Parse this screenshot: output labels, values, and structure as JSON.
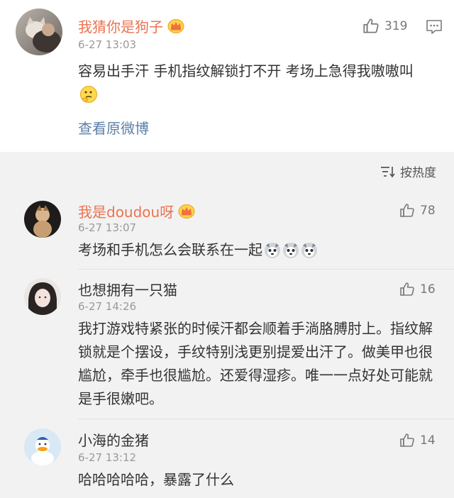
{
  "original_post": {
    "username": "我猜你是狗子",
    "time": "6-27 13:03",
    "likes": "319",
    "body": "容易出手汗 手机指纹解锁打不开 考场上急得我嗷嗷叫",
    "view_original": "查看原微博"
  },
  "sort": {
    "label": "按热度"
  },
  "comments": [
    {
      "username": "我是doudou呀",
      "time": "6-27 13:07",
      "likes": "78",
      "body": "考场和手机怎么会联系在一起"
    },
    {
      "username": "也想拥有一只猫",
      "time": "6-27 14:26",
      "likes": "16",
      "body": "我打游戏特紧张的时候汗都会顺着手淌胳膊肘上。指纹解锁就是个摆设，手纹特别浅更别提爱出汗了。做美甲也很尴尬，牵手也很尴尬。还爱得湿疹。唯一一点好处可能就是手很嫩吧。"
    },
    {
      "username": "小海的金猪",
      "time": "6-27 13:12",
      "likes": "14",
      "body": "哈哈哈哈哈，暴露了什么"
    }
  ],
  "colors": {
    "vip_name": "#eb7350",
    "link": "#5b7fa8",
    "meta": "#999999"
  },
  "icons": [
    "thumbs-up-icon",
    "comment-icon",
    "crown-icon",
    "sort-icon",
    "thinking-emoji",
    "husky-emoji"
  ]
}
